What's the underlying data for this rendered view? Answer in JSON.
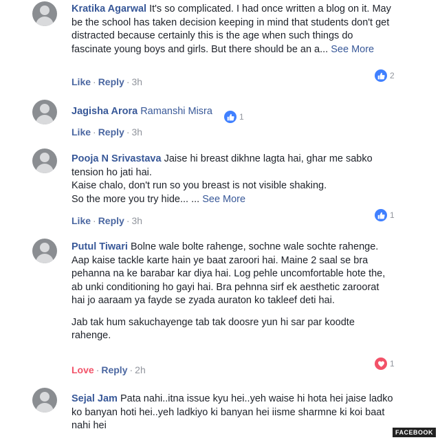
{
  "comments": [
    {
      "author": "Kratika Agarwal",
      "text": "It's so complicated. I had once written a blog on it. May be the school has taken decision keeping in mind that students don't get distracted because certainly this is the age when such things do fascinate young boys and girls. But there should be an a...",
      "see_more": "See More",
      "action": "Like",
      "reply": "Reply",
      "time": "3h",
      "reaction": "like",
      "reaction_count": "2"
    },
    {
      "author": "Jagisha Arora",
      "text": "Ramanshi Misra",
      "action": "Like",
      "reply": "Reply",
      "time": "3h",
      "reaction": "like",
      "reaction_count": "1"
    },
    {
      "author": "Pooja N Srivastava",
      "text_lines": [
        "Jaise hi breast dikhne lagta hai, ghar me sabko tension ho jati hai.",
        "Kaise chalo, don't run so you breast is not visible shaking.",
        "So the more you try hide... ..."
      ],
      "see_more": "See More",
      "action": "Like",
      "reply": "Reply",
      "time": "3h",
      "reaction": "like",
      "reaction_count": "1"
    },
    {
      "author": "Putul Tiwari",
      "paragraphs": [
        "Bolne wale bolte rahenge, sochne wale sochte rahenge. Aap kaise tackle karte hain ye baat zaroori hai. Maine 2 saal se bra pehanna na ke barabar kar diya hai. Log pehle uncomfortable hote the, ab unki conditioning ho gayi hai. Bra pehnna sirf ek aesthetic zaroorat hai jo aaraam ya fayde se zyada auraton ko takleef deti hai.",
        "Jab tak hum sakuchayenge tab tak doosre yun hi sar par koodte rahenge."
      ],
      "action": "Love",
      "reply": "Reply",
      "time": "2h",
      "reaction": "love",
      "reaction_count": "1"
    },
    {
      "author": "Sejal Jam",
      "text": "Pata nahi..itna issue kyu hei..yeh waise hi hota hei jaise ladko ko banyan hoti hei..yeh ladkiyo ki banyan hei iisme sharmne ki koi baat nahi hei"
    }
  ],
  "watermark": "FACEBOOK",
  "colors": {
    "link": "#385898",
    "like_blue": "#4080ff",
    "love_red": "#f25268",
    "meta_gray": "#90949c"
  }
}
